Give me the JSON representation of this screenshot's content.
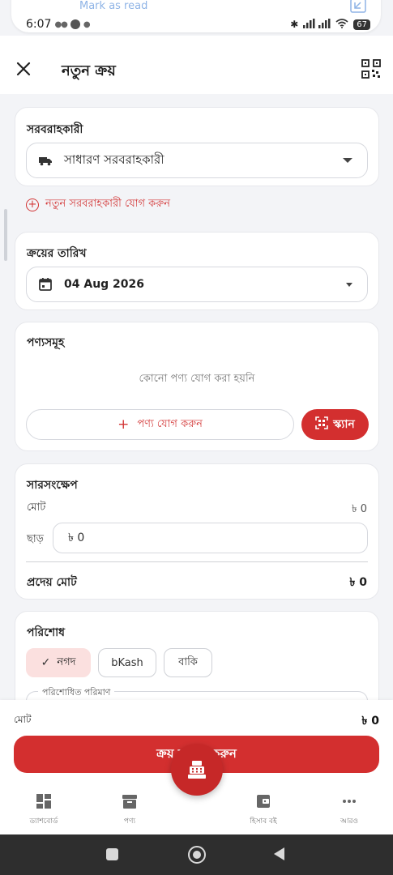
{
  "notification": {
    "action_label": "Mark as read"
  },
  "status_bar": {
    "time": "6:07",
    "battery": "67"
  },
  "header": {
    "title": "নতুন ক্রয়"
  },
  "supplier": {
    "title": "সরবরাহকারী",
    "selected": "সাধারণ সরবরাহকারী",
    "add_label": "নতুন সরবরাহকারী যোগ করুন"
  },
  "purchase_date": {
    "title": "ক্রয়ের তারিখ",
    "value": "04 Aug 2026"
  },
  "products": {
    "title": "পণ্যসমূহ",
    "empty_message": "কোনো পণ্য যোগ করা হয়নি",
    "add_label": "পণ্য যোগ করুন",
    "scan_label": "স্ক্যান"
  },
  "summary": {
    "title": "সারসংক্ষেপ",
    "total_label": "মোট",
    "total_value": "৳ 0",
    "discount_label": "ছাড়",
    "discount_value": "৳ 0",
    "payable_label": "প্রদেয় মোট",
    "payable_value": "৳ 0"
  },
  "payment": {
    "title": "পরিশোধ",
    "methods": [
      "নগদ",
      "bKash",
      "বাকি"
    ],
    "selected_method": "নগদ",
    "paid_amount_label": "পরিশোধিত পরিমাণ"
  },
  "footer": {
    "total_label": "মোট",
    "total_value": "৳ 0",
    "complete_button": "ক্রয় সম্পন্ন করুন"
  },
  "bottom_nav": {
    "items": [
      "ড্যাশবোর্ড",
      "পণ্য",
      "হিসাব বই",
      "আরও"
    ]
  },
  "colors": {
    "accent": "#d32f2f",
    "selected_chip": "#fbe0df",
    "background": "#f3f4f7"
  }
}
